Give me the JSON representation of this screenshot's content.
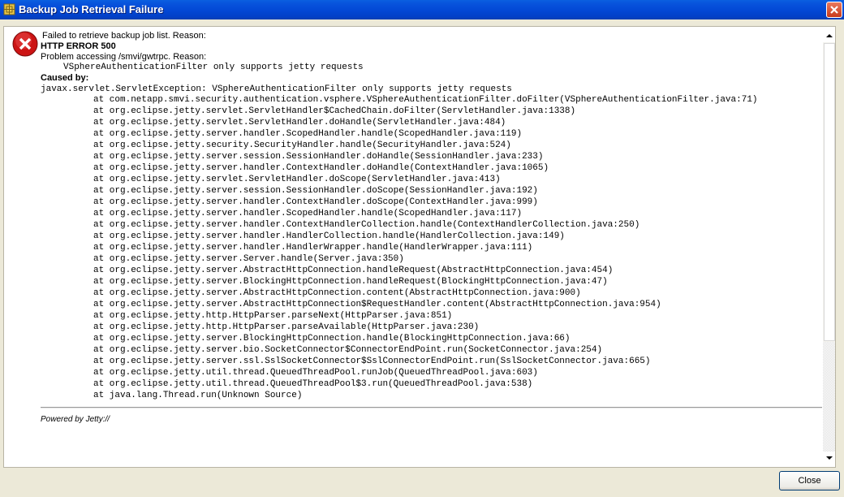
{
  "window": {
    "title": "Backup Job Retrieval Failure",
    "close_label": "Close"
  },
  "message": {
    "line1": "Failed to retrieve backup job list. Reason:",
    "line2": "HTTP ERROR 500",
    "line3": "Problem accessing /smvi/gwtrpc. Reason:",
    "line4": "VSphereAuthenticationFilter only supports jetty requests",
    "caused_by": "Caused by:",
    "exception": "javax.servlet.ServletException: VSphereAuthenticationFilter only supports jetty requests"
  },
  "stack_trace": [
    "at com.netapp.smvi.security.authentication.vsphere.VSphereAuthenticationFilter.doFilter(VSphereAuthenticationFilter.java:71)",
    "at org.eclipse.jetty.servlet.ServletHandler$CachedChain.doFilter(ServletHandler.java:1338)",
    "at org.eclipse.jetty.servlet.ServletHandler.doHandle(ServletHandler.java:484)",
    "at org.eclipse.jetty.server.handler.ScopedHandler.handle(ScopedHandler.java:119)",
    "at org.eclipse.jetty.security.SecurityHandler.handle(SecurityHandler.java:524)",
    "at org.eclipse.jetty.server.session.SessionHandler.doHandle(SessionHandler.java:233)",
    "at org.eclipse.jetty.server.handler.ContextHandler.doHandle(ContextHandler.java:1065)",
    "at org.eclipse.jetty.servlet.ServletHandler.doScope(ServletHandler.java:413)",
    "at org.eclipse.jetty.server.session.SessionHandler.doScope(SessionHandler.java:192)",
    "at org.eclipse.jetty.server.handler.ContextHandler.doScope(ContextHandler.java:999)",
    "at org.eclipse.jetty.server.handler.ScopedHandler.handle(ScopedHandler.java:117)",
    "at org.eclipse.jetty.server.handler.ContextHandlerCollection.handle(ContextHandlerCollection.java:250)",
    "at org.eclipse.jetty.server.handler.HandlerCollection.handle(HandlerCollection.java:149)",
    "at org.eclipse.jetty.server.handler.HandlerWrapper.handle(HandlerWrapper.java:111)",
    "at org.eclipse.jetty.server.Server.handle(Server.java:350)",
    "at org.eclipse.jetty.server.AbstractHttpConnection.handleRequest(AbstractHttpConnection.java:454)",
    "at org.eclipse.jetty.server.BlockingHttpConnection.handleRequest(BlockingHttpConnection.java:47)",
    "at org.eclipse.jetty.server.AbstractHttpConnection.content(AbstractHttpConnection.java:900)",
    "at org.eclipse.jetty.server.AbstractHttpConnection$RequestHandler.content(AbstractHttpConnection.java:954)",
    "at org.eclipse.jetty.http.HttpParser.parseNext(HttpParser.java:851)",
    "at org.eclipse.jetty.http.HttpParser.parseAvailable(HttpParser.java:230)",
    "at org.eclipse.jetty.server.BlockingHttpConnection.handle(BlockingHttpConnection.java:66)",
    "at org.eclipse.jetty.server.bio.SocketConnector$ConnectorEndPoint.run(SocketConnector.java:254)",
    "at org.eclipse.jetty.server.ssl.SslSocketConnector$SslConnectorEndPoint.run(SslSocketConnector.java:665)",
    "at org.eclipse.jetty.util.thread.QueuedThreadPool.runJob(QueuedThreadPool.java:603)",
    "at org.eclipse.jetty.util.thread.QueuedThreadPool$3.run(QueuedThreadPool.java:538)",
    "at java.lang.Thread.run(Unknown Source)"
  ],
  "footer": "Powered by Jetty://",
  "icons": {
    "app": "vm-icon",
    "error": "error-x-icon",
    "title_close": "close-icon"
  },
  "colors": {
    "titlebar": "#0349d6",
    "error_red": "#cc1414",
    "close_red": "#c8391a"
  }
}
